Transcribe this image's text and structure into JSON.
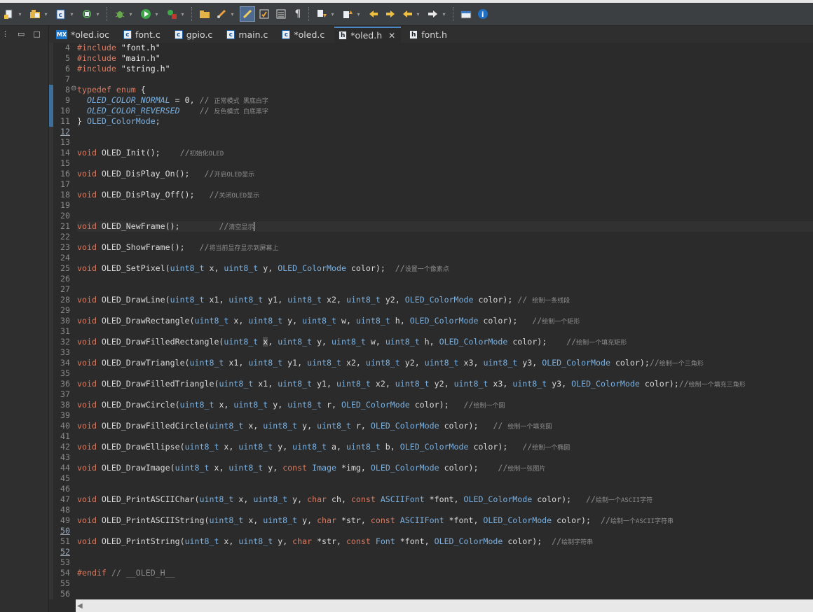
{
  "toolbar": {
    "buttons": [
      "new-icon",
      "open-project-icon",
      "new-c-file-icon",
      "sync-icon",
      "debug-icon",
      "run-icon",
      "external-tools-icon",
      "open-folder-icon",
      "brush-icon",
      "highlight-icon",
      "toggle-mark-icon",
      "block-select-icon",
      "whitespace-icon",
      "next-annotation-icon",
      "prev-annotation-icon",
      "back-icon",
      "forward-icon",
      "next-edit-icon",
      "last-edit-icon",
      "open-perspective-icon",
      "info-icon"
    ]
  },
  "tabs": [
    {
      "label": "*oled.ioc",
      "kind": "mx",
      "active": false
    },
    {
      "label": "font.c",
      "kind": "c",
      "active": false
    },
    {
      "label": "gpio.c",
      "kind": "c",
      "active": false
    },
    {
      "label": "main.c",
      "kind": "c",
      "active": false
    },
    {
      "label": "*oled.c",
      "kind": "c",
      "active": false
    },
    {
      "label": "*oled.h",
      "kind": "h",
      "active": true
    },
    {
      "label": "font.h",
      "kind": "h",
      "active": false
    }
  ],
  "tab_icon_labels": {
    "mx": "MX",
    "c": "c",
    "h": "h"
  },
  "close_glyph": "✕",
  "code_lines": [
    {
      "n": "4",
      "html": "<span class=\"pp\">#include</span> <span class=\"str\">\"font.h\"</span>"
    },
    {
      "n": "5",
      "html": "<span class=\"pp\">#include</span> <span class=\"str\">\"main.h\"</span>"
    },
    {
      "n": "6",
      "html": "<span class=\"pp\">#include</span> <span class=\"str\">\"string.h\"</span>"
    },
    {
      "n": "7",
      "html": ""
    },
    {
      "n": "8",
      "html": "<span class=\"kw\">typedef</span> <span class=\"kw\">enum</span> {",
      "fold": true
    },
    {
      "n": "9",
      "html": "  <span class=\"en it\">OLED_COLOR_NORMAL</span> = <span class=\"num\">0</span>, <span class=\"cm\">// </span><span class=\"cmcn\">正常模式 黑底白字</span>"
    },
    {
      "n": "10",
      "html": "  <span class=\"en it\">OLED_COLOR_REVERSED</span>    <span class=\"cm\">// </span><span class=\"cmcn\">反色模式 白底黑字</span>"
    },
    {
      "n": "11",
      "html": "} <span class=\"ty\">OLED_ColorMode</span>;"
    },
    {
      "n": "12",
      "html": ""
    },
    {
      "n": "13",
      "html": ""
    },
    {
      "n": "14",
      "html": "<span class=\"kw\">void</span> OLED_Init();    <span class=\"cm\">//</span><span class=\"cmcn\">初始化OLED</span>"
    },
    {
      "n": "15",
      "html": ""
    },
    {
      "n": "16",
      "html": "<span class=\"kw\">void</span> OLED_DisPlay_On();   <span class=\"cm\">//</span><span class=\"cmcn\">开启OLED显示</span>"
    },
    {
      "n": "17",
      "html": ""
    },
    {
      "n": "18",
      "html": "<span class=\"kw\">void</span> OLED_DisPlay_Off();   <span class=\"cm\">//</span><span class=\"cmcn\">关闭OLED显示</span>"
    },
    {
      "n": "19",
      "html": ""
    },
    {
      "n": "20",
      "html": ""
    },
    {
      "n": "21",
      "html": "<span class=\"kw\">void</span> OLED_NewFrame();        <span class=\"cm\">//</span><span class=\"cmcn\">清空显示</span><span class=\"caret\"></span>",
      "current": true
    },
    {
      "n": "22",
      "html": ""
    },
    {
      "n": "23",
      "html": "<span class=\"kw\">void</span> OLED_ShowFrame();   <span class=\"cm\">//</span><span class=\"cmcn\">将当前显存显示到屏幕上</span>"
    },
    {
      "n": "24",
      "html": ""
    },
    {
      "n": "25",
      "html": "<span class=\"kw\">void</span> OLED_SetPixel(<span class=\"ty\">uint8_t</span> x, <span class=\"ty\">uint8_t</span> y, <span class=\"ty\">OLED_ColorMode</span> color);  <span class=\"cm\">//</span><span class=\"cmcn\">设置一个像素点</span>"
    },
    {
      "n": "26",
      "html": ""
    },
    {
      "n": "27",
      "html": ""
    },
    {
      "n": "28",
      "html": "<span class=\"kw\">void</span> OLED_DrawLine(<span class=\"ty\">uint8_t</span> x1, <span class=\"ty\">uint8_t</span> y1, <span class=\"ty\">uint8_t</span> x2, <span class=\"ty\">uint8_t</span> y2, <span class=\"ty\">OLED_ColorMode</span> color); <span class=\"cm\">// </span><span class=\"cmcn\">绘制一条线段</span>"
    },
    {
      "n": "29",
      "html": ""
    },
    {
      "n": "30",
      "html": "<span class=\"kw\">void</span> OLED_DrawRectangle(<span class=\"ty\">uint8_t</span> x, <span class=\"ty\">uint8_t</span> y, <span class=\"ty\">uint8_t</span> w, <span class=\"ty\">uint8_t</span> h, <span class=\"ty\">OLED_ColorMode</span> color);   <span class=\"cm\">//</span><span class=\"cmcn\">绘制一个矩形</span>"
    },
    {
      "n": "31",
      "html": ""
    },
    {
      "n": "32",
      "html": "<span class=\"kw\">void</span> OLED_DrawFilledRectangle(<span class=\"ty\">uint8_t</span> <span class=\"xsel\">x</span>, <span class=\"ty\">uint8_t</span> y, <span class=\"ty\">uint8_t</span> w, <span class=\"ty\">uint8_t</span> h, <span class=\"ty\">OLED_ColorMode</span> color);    <span class=\"cm\">//</span><span class=\"cmcn\">绘制一个填充矩形</span>"
    },
    {
      "n": "33",
      "html": ""
    },
    {
      "n": "34",
      "html": "<span class=\"kw\">void</span> OLED_DrawTriangle(<span class=\"ty\">uint8_t</span> x1, <span class=\"ty\">uint8_t</span> y1, <span class=\"ty\">uint8_t</span> x2, <span class=\"ty\">uint8_t</span> y2, <span class=\"ty\">uint8_t</span> x3, <span class=\"ty\">uint8_t</span> y3, <span class=\"ty\">OLED_ColorMode</span> color);<span class=\"cm\">//</span><span class=\"cmcn\">绘制一个三角形</span>"
    },
    {
      "n": "35",
      "html": ""
    },
    {
      "n": "36",
      "html": "<span class=\"kw\">void</span> OLED_DrawFilledTriangle(<span class=\"ty\">uint8_t</span> x1, <span class=\"ty\">uint8_t</span> y1, <span class=\"ty\">uint8_t</span> x2, <span class=\"ty\">uint8_t</span> y2, <span class=\"ty\">uint8_t</span> x3, <span class=\"ty\">uint8_t</span> y3, <span class=\"ty\">OLED_ColorMode</span> color);<span class=\"cm\">//</span><span class=\"cmcn\">绘制一个填充三角形</span>"
    },
    {
      "n": "37",
      "html": ""
    },
    {
      "n": "38",
      "html": "<span class=\"kw\">void</span> OLED_DrawCircle(<span class=\"ty\">uint8_t</span> x, <span class=\"ty\">uint8_t</span> y, <span class=\"ty\">uint8_t</span> r, <span class=\"ty\">OLED_ColorMode</span> color);   <span class=\"cm\">//</span><span class=\"cmcn\">绘制一个圆</span>"
    },
    {
      "n": "39",
      "html": ""
    },
    {
      "n": "40",
      "html": "<span class=\"kw\">void</span> OLED_DrawFilledCircle(<span class=\"ty\">uint8_t</span> x, <span class=\"ty\">uint8_t</span> y, <span class=\"ty\">uint8_t</span> r, <span class=\"ty\">OLED_ColorMode</span> color);   <span class=\"cm\">// </span><span class=\"cmcn\">绘制一个填充圆</span>"
    },
    {
      "n": "41",
      "html": ""
    },
    {
      "n": "42",
      "html": "<span class=\"kw\">void</span> OLED_DrawEllipse(<span class=\"ty\">uint8_t</span> x, <span class=\"ty\">uint8_t</span> y, <span class=\"ty\">uint8_t</span> a, <span class=\"ty\">uint8_t</span> b, <span class=\"ty\">OLED_ColorMode</span> color);   <span class=\"cm\">//</span><span class=\"cmcn\">绘制一个椭圆</span>"
    },
    {
      "n": "43",
      "html": ""
    },
    {
      "n": "44",
      "html": "<span class=\"kw\">void</span> OLED_DrawImage(<span class=\"ty\">uint8_t</span> x, <span class=\"ty\">uint8_t</span> y, <span class=\"kw\">const</span> <span class=\"ty\">Image</span> *img, <span class=\"ty\">OLED_ColorMode</span> color);    <span class=\"cm\">//</span><span class=\"cmcn\">绘制一张图片</span>"
    },
    {
      "n": "45",
      "html": ""
    },
    {
      "n": "46",
      "html": ""
    },
    {
      "n": "47",
      "html": "<span class=\"kw\">void</span> OLED_PrintASCIIChar(<span class=\"ty\">uint8_t</span> x, <span class=\"ty\">uint8_t</span> y, <span class=\"kw\">char</span> ch, <span class=\"kw\">const</span> <span class=\"ty\">ASCIIFont</span> *font, <span class=\"ty\">OLED_ColorMode</span> color);   <span class=\"cm\">//</span><span class=\"cmcn\">绘制一个ASCII字符</span>"
    },
    {
      "n": "48",
      "html": ""
    },
    {
      "n": "49",
      "html": "<span class=\"kw\">void</span> OLED_PrintASCIIString(<span class=\"ty\">uint8_t</span> x, <span class=\"ty\">uint8_t</span> y, <span class=\"kw\">char</span> *str, <span class=\"kw\">const</span> <span class=\"ty\">ASCIIFont</span> *font, <span class=\"ty\">OLED_ColorMode</span> color);  <span class=\"cm\">//</span><span class=\"cmcn\">绘制一个ASCII字符串</span>"
    },
    {
      "n": "50",
      "html": ""
    },
    {
      "n": "51",
      "html": "<span class=\"kw\">void</span> OLED_PrintString(<span class=\"ty\">uint8_t</span> x, <span class=\"ty\">uint8_t</span> y, <span class=\"kw\">char</span> *str, <span class=\"kw\">const</span> <span class=\"ty\">Font</span> *font, <span class=\"ty\">OLED_ColorMode</span> color);  <span class=\"cm\">//</span><span class=\"cmcn\">绘制字符串</span>"
    },
    {
      "n": "52",
      "html": ""
    },
    {
      "n": "53",
      "html": ""
    },
    {
      "n": "54",
      "html": "<span class=\"pp\">#endif</span> <span class=\"cm\">// __OLED_H__</span>"
    },
    {
      "n": "55",
      "html": ""
    },
    {
      "n": "56",
      "html": ""
    }
  ],
  "colors": {
    "keyword": "#d97b62",
    "type": "#7ab0e0",
    "comment": "#8c8c8c",
    "background": "#2b2b2b",
    "active_tab_border": "#4a88c7"
  }
}
